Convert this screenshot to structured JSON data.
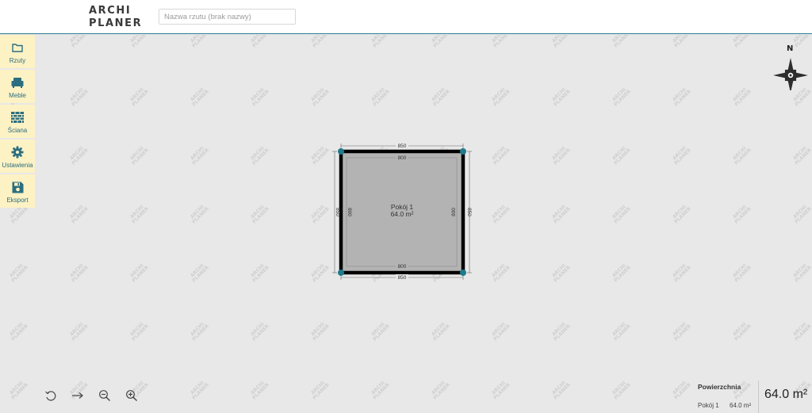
{
  "app": {
    "logo_line1": "ARCHI",
    "logo_line2": "PLANER",
    "plan_name_placeholder": "Nazwa rzutu (brak nazwy)",
    "plan_name_value": ""
  },
  "watermark": {
    "line1": "ARCHI",
    "line2": "PLANER"
  },
  "sidebar": {
    "items": [
      {
        "label": "Rzuty",
        "icon": "folder-icon"
      },
      {
        "label": "Meble",
        "icon": "armchair-icon"
      },
      {
        "label": "Ściana",
        "icon": "brick-wall-icon"
      },
      {
        "label": "Ustawienia",
        "icon": "gear-icon"
      },
      {
        "label": "Eksport",
        "icon": "floppy-disk-icon"
      }
    ]
  },
  "compass": {
    "north_label": "N",
    "icon": "compass-rose-icon"
  },
  "room": {
    "name": "Pokój 1",
    "area": "64.0 m²",
    "dim_outer_top": "850",
    "dim_inner_top": "800",
    "dim_inner_bottom": "800",
    "dim_outer_bottom": "850",
    "dim_outer_left": "850",
    "dim_inner_left": "800",
    "dim_inner_right": "800",
    "dim_outer_right": "850",
    "fill_color": "#b3b3b3",
    "wall_color": "#000000",
    "corner_color": "#1f7a8c"
  },
  "toolbar": {
    "items": [
      {
        "name": "undo",
        "icon": "undo-icon"
      },
      {
        "name": "redo",
        "icon": "arrow-right-icon"
      },
      {
        "name": "zoom-out",
        "icon": "zoom-out-icon"
      },
      {
        "name": "zoom-in",
        "icon": "zoom-in-icon"
      }
    ]
  },
  "area_panel": {
    "title": "Powierzchnia",
    "rooms": [
      {
        "name": "Pokój 1",
        "area": "64.0 m²"
      }
    ],
    "total": "64.0 m²"
  },
  "colors": {
    "accent": "#2a7e92",
    "sidebar_bg": "#fdf2c4",
    "canvas_bg": "#e8e8e8"
  }
}
